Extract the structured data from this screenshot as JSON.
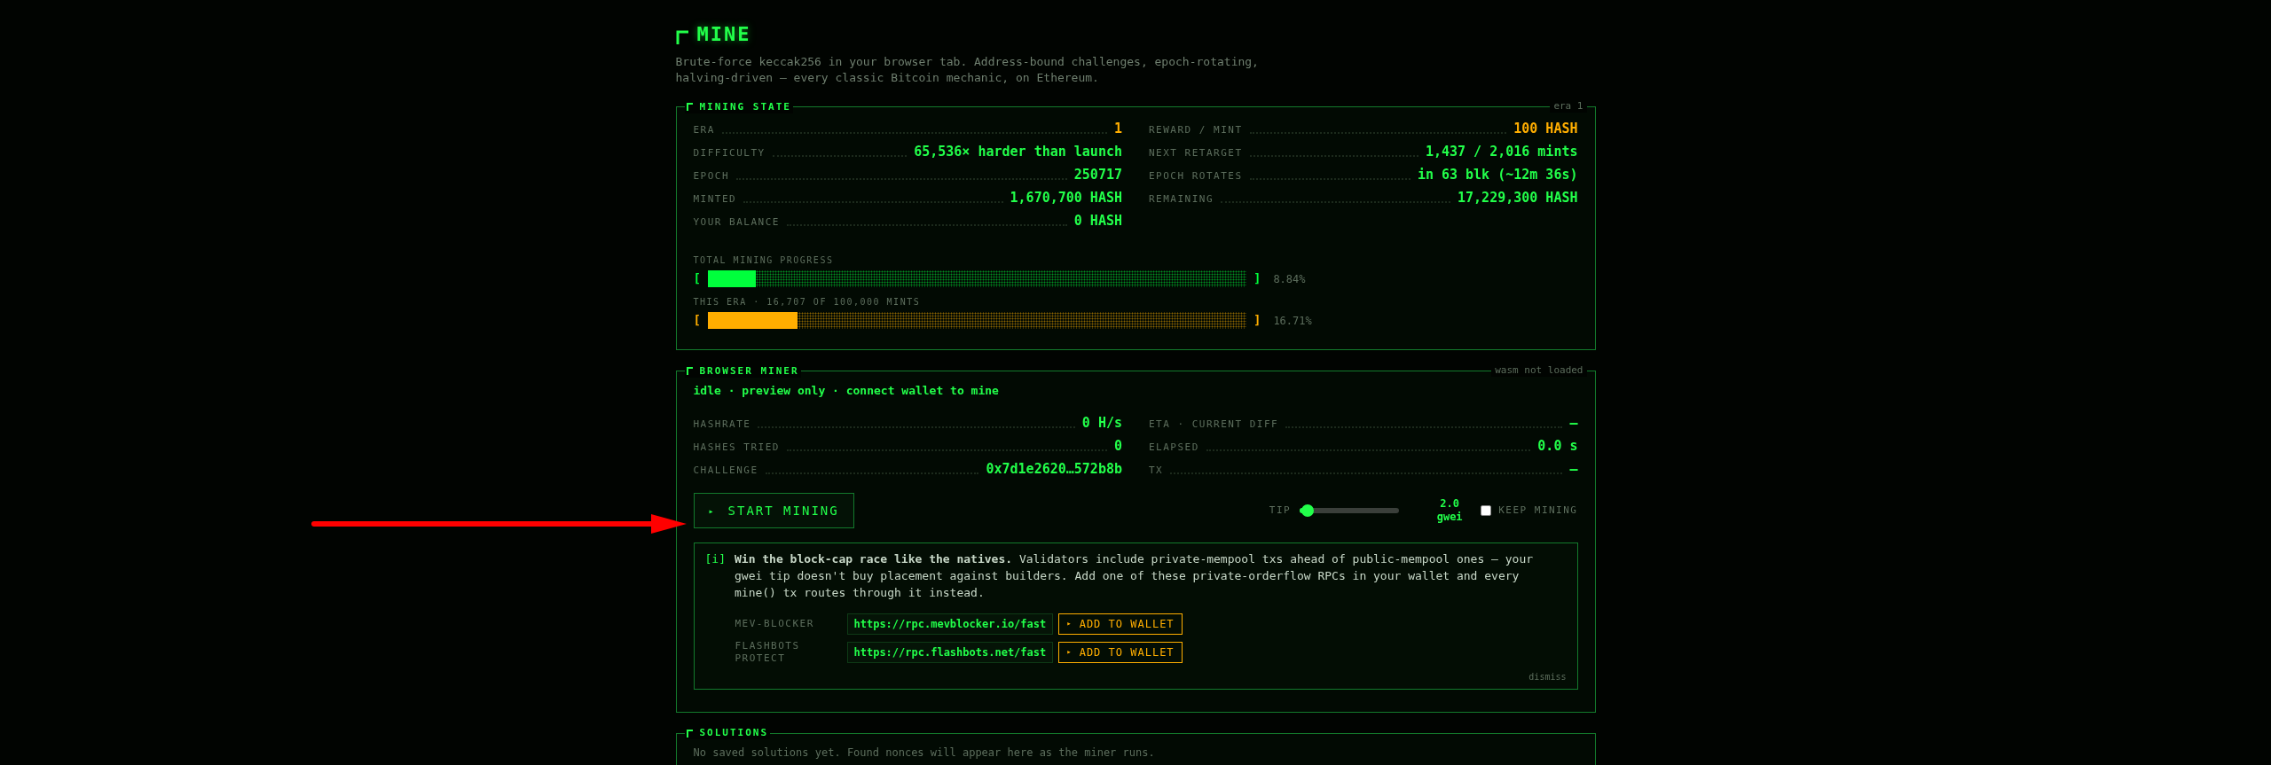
{
  "header": {
    "title": "MINE",
    "description": "Brute-force keccak256 in your browser tab. Address-bound challenges, epoch-rotating, halving-driven — every classic Bitcoin mechanic, on Ethereum."
  },
  "mining_state": {
    "title": "MINING STATE",
    "badge": "era 1",
    "left_stats": [
      {
        "label": "ERA",
        "value": "1",
        "highlight": true
      },
      {
        "label": "DIFFICULTY",
        "value": "65,536× harder than launch",
        "highlight": false
      },
      {
        "label": "EPOCH",
        "value": "250717",
        "highlight": false
      },
      {
        "label": "MINTED",
        "value": "1,670,700 HASH",
        "highlight": false
      },
      {
        "label": "YOUR BALANCE",
        "value": "0 HASH",
        "highlight": false
      }
    ],
    "right_stats": [
      {
        "label": "REWARD / MINT",
        "value": "100 HASH",
        "highlight": true
      },
      {
        "label": "NEXT RETARGET",
        "value": "1,437 / 2,016 mints",
        "highlight": false
      },
      {
        "label": "EPOCH ROTATES",
        "value": "in 63 blk (~12m 36s)",
        "highlight": false
      },
      {
        "label": "REMAINING",
        "value": "17,229,300 HASH",
        "highlight": false
      }
    ],
    "progress": [
      {
        "label": "TOTAL MINING PROGRESS",
        "open": "[",
        "close": "]",
        "level": 0.0884,
        "reading": "8.84%",
        "color": "#00ff3c"
      },
      {
        "label": "THIS ERA · 16,707 OF 100,000 MINTS",
        "open": "[",
        "close": "]",
        "level": 0.1671,
        "reading": "16.71%",
        "color": "#ffae00"
      }
    ]
  },
  "browser_miner": {
    "title": "BROWSER MINER",
    "badge": "wasm not loaded",
    "status": "idle · preview only · connect wallet to mine",
    "left_stats": [
      {
        "label": "HASHRATE",
        "value": "0 H/s"
      },
      {
        "label": "HASHES TRIED",
        "value": "0"
      },
      {
        "label": "CHALLENGE",
        "value": "0x7d1e2620…572b8b"
      }
    ],
    "right_stats": [
      {
        "label": "ETA · CURRENT DIFF",
        "value": "—"
      },
      {
        "label": "ELAPSED",
        "value": "0.0 s"
      },
      {
        "label": "TX",
        "value": "—"
      }
    ],
    "start_button": {
      "icon": "▸",
      "label": "START MINING"
    },
    "tip": {
      "label": "TIP",
      "level": 0.05,
      "reading": "2.0 gwei"
    },
    "keep_mining": {
      "label": "KEEP MINING",
      "checked": false
    },
    "notice": {
      "marker": "[i]",
      "text": "**Win the block-cap race like the natives.** Validators include private-mempool txs ahead of public-mempool ones — your gwei tip doesn't buy placement against builders. Add one of these private-orderflow RPCs in your wallet and every mine() tx routes through it instead.",
      "rpcs": [
        {
          "name": "MEV-BLOCKER",
          "url": "https://rpc.mevblocker.io/fast",
          "button_icon": "▸",
          "button": "ADD TO WALLET"
        },
        {
          "name": "FLASHBOTS PROTECT",
          "url": "https://rpc.flashbots.net/fast",
          "button_icon": "▸",
          "button": "ADD TO WALLET"
        }
      ],
      "dismiss": "dismiss"
    }
  },
  "solutions": {
    "title": "SOLUTIONS",
    "empty_text": "No saved solutions yet. Found nonces will appear here as the miner runs."
  }
}
